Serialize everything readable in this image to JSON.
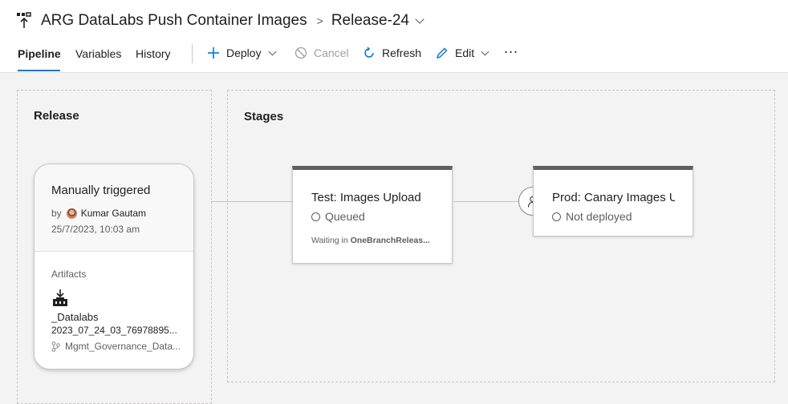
{
  "header": {
    "pipeline_title": "ARG DataLabs Push Container Images",
    "release_name": "Release-24"
  },
  "tabs": [
    {
      "label": "Pipeline",
      "active": true
    },
    {
      "label": "Variables",
      "active": false
    },
    {
      "label": "History",
      "active": false
    }
  ],
  "toolbar": {
    "deploy_label": "Deploy",
    "cancel_label": "Cancel",
    "refresh_label": "Refresh",
    "edit_label": "Edit",
    "more_label": "..."
  },
  "release_panel": {
    "title": "Release",
    "trigger": "Manually triggered",
    "by_prefix": "by",
    "user": "Kumar Gautam",
    "timestamp": "25/7/2023, 10:03 am",
    "artifacts_label": "Artifacts",
    "artifact_name": "_Datalabs",
    "artifact_version": "2023_07_24_03_76978895...",
    "artifact_branch": "Mgmt_Governance_Data..."
  },
  "stages_panel": {
    "title": "Stages",
    "stages": [
      {
        "name": "Test: Images Upload",
        "status": "Queued",
        "waiting_prefix": "Waiting in",
        "waiting_target": "OneBranchReleas..."
      },
      {
        "name": "Prod: Canary Images U",
        "status": "Not deployed"
      }
    ]
  },
  "colors": {
    "accent": "#0078d4",
    "stage_bar": "#605e5c",
    "background": "#f3f3f3"
  }
}
